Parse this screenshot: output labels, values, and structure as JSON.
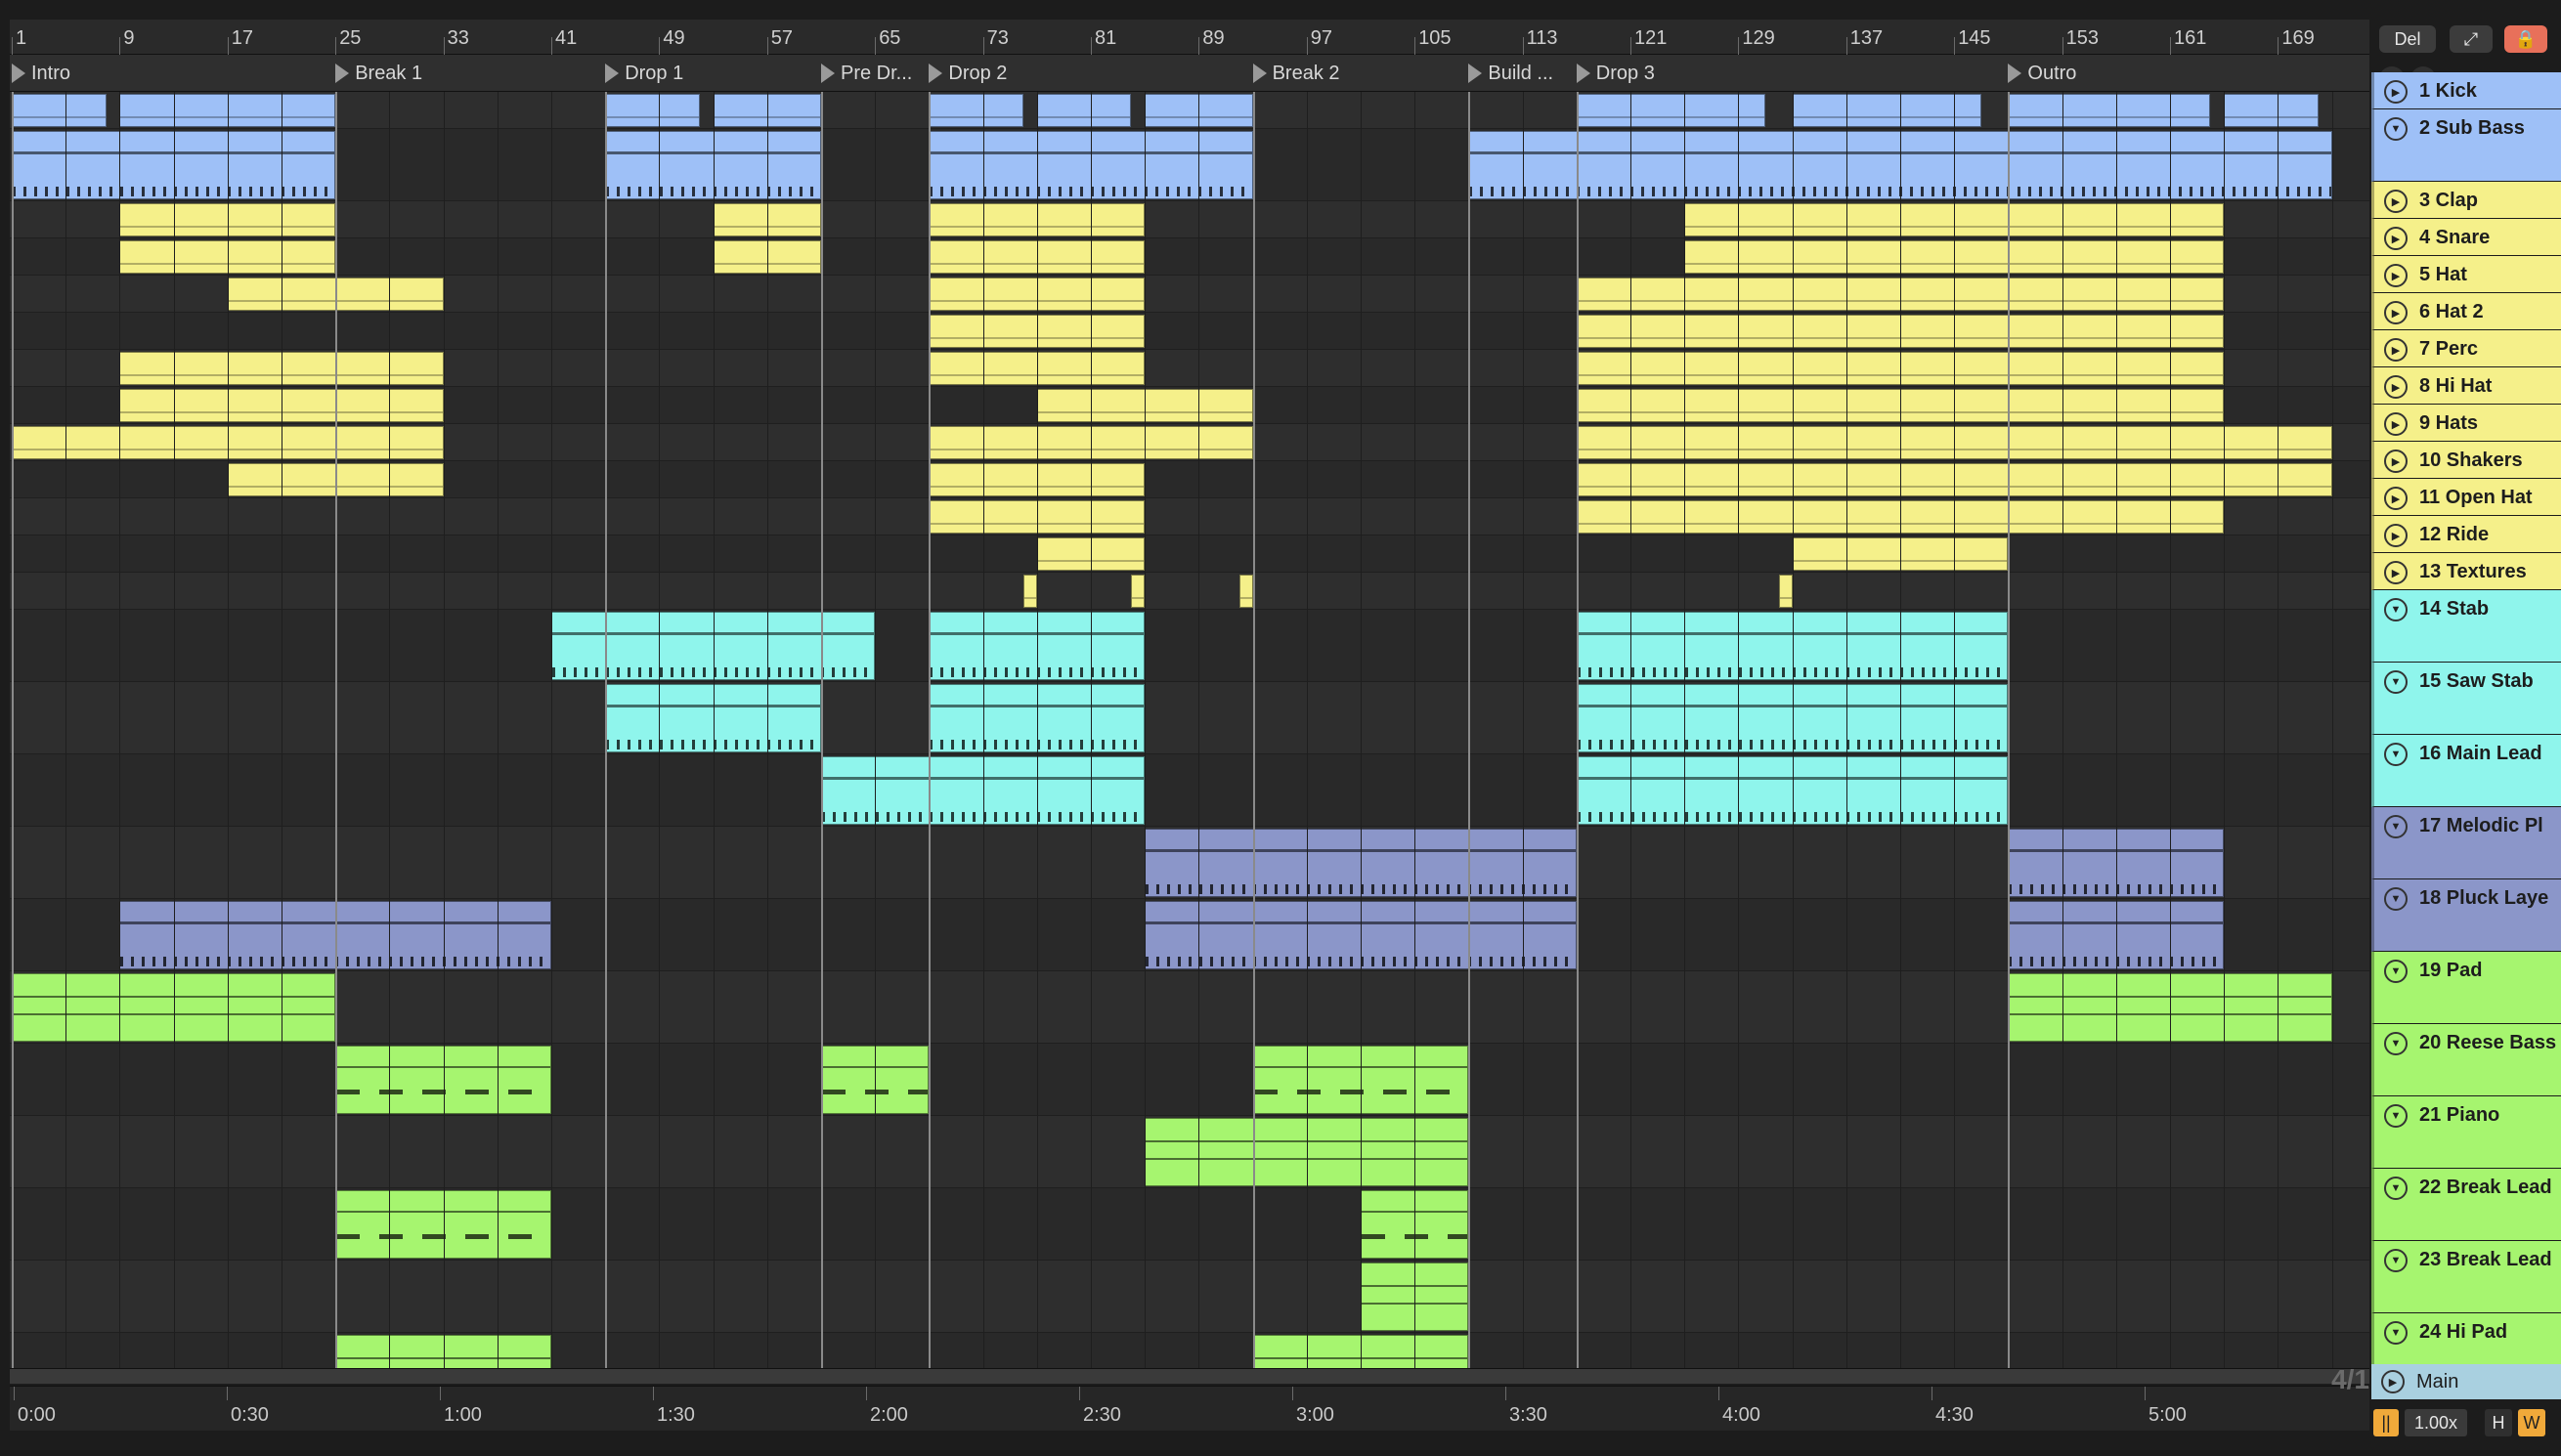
{
  "colors": {
    "blue": "#9ec0f7",
    "yellow": "#f5f08a",
    "cyan": "#8ff5ec",
    "violet": "#8b96c9",
    "green": "#a6f56f",
    "main": "#a9d0e0",
    "lock": "#e8705a",
    "orange": "#f0a93a"
  },
  "ruler": {
    "bars": [
      "1",
      "9",
      "17",
      "25",
      "33",
      "41",
      "49",
      "57",
      "65",
      "73",
      "81",
      "89",
      "97",
      "105",
      "113",
      "121",
      "129",
      "137",
      "145",
      "153",
      "161",
      "169"
    ]
  },
  "locators": [
    {
      "name": "Intro",
      "bar": 1
    },
    {
      "name": "Break 1",
      "bar": 25
    },
    {
      "name": "Drop 1",
      "bar": 45
    },
    {
      "name": "Pre Dr...",
      "bar": 61
    },
    {
      "name": "Drop 2",
      "bar": 69
    },
    {
      "name": "Break 2",
      "bar": 93
    },
    {
      "name": "Build ...",
      "bar": 109
    },
    {
      "name": "Drop 3",
      "bar": 117
    },
    {
      "name": "Outro",
      "bar": 149
    }
  ],
  "timeline": {
    "labels": [
      "0:00",
      "0:30",
      "1:00",
      "1:30",
      "2:00",
      "2:30",
      "3:00",
      "3:30",
      "4:00",
      "4:30",
      "5:00"
    ]
  },
  "zoom_readout": "4/1",
  "header_controls": {
    "del_label": "Del",
    "tempo_scale": "1.00x",
    "h_label": "H",
    "w_label": "W"
  },
  "main_track": {
    "name": "Main"
  },
  "tracks": [
    {
      "name": "1 Kick",
      "color": "blue",
      "h": 38,
      "kind": "audio",
      "clips": [
        [
          1,
          8
        ],
        [
          9,
          25
        ],
        [
          45,
          52
        ],
        [
          53,
          61
        ],
        [
          69,
          76
        ],
        [
          77,
          84
        ],
        [
          85,
          93
        ],
        [
          117,
          131
        ],
        [
          133,
          147
        ],
        [
          149,
          164
        ],
        [
          165,
          172
        ]
      ]
    },
    {
      "name": "2 Sub Bass",
      "color": "blue",
      "h": 74,
      "kind": "midi",
      "clips": [
        [
          1,
          25
        ],
        [
          45,
          61
        ],
        [
          69,
          93
        ],
        [
          109,
          173
        ]
      ]
    },
    {
      "name": "3 Clap",
      "color": "yellow",
      "h": 38,
      "kind": "audio",
      "clips": [
        [
          9,
          25
        ],
        [
          53,
          61
        ],
        [
          69,
          85
        ],
        [
          125,
          165
        ]
      ]
    },
    {
      "name": "4 Snare",
      "color": "yellow",
      "h": 38,
      "kind": "audio",
      "clips": [
        [
          9,
          25
        ],
        [
          53,
          61
        ],
        [
          69,
          85
        ],
        [
          125,
          165
        ]
      ]
    },
    {
      "name": "5 Hat",
      "color": "yellow",
      "h": 38,
      "kind": "audio",
      "clips": [
        [
          17,
          33
        ],
        [
          69,
          85
        ],
        [
          117,
          165
        ]
      ]
    },
    {
      "name": "6 Hat 2",
      "color": "yellow",
      "h": 38,
      "kind": "audio",
      "clips": [
        [
          69,
          85
        ],
        [
          117,
          165
        ]
      ]
    },
    {
      "name": "7 Perc",
      "color": "yellow",
      "h": 38,
      "kind": "audio",
      "clips": [
        [
          9,
          33
        ],
        [
          69,
          85
        ],
        [
          117,
          165
        ]
      ]
    },
    {
      "name": "8 Hi Hat",
      "color": "yellow",
      "h": 38,
      "kind": "audio",
      "clips": [
        [
          9,
          33
        ],
        [
          77,
          93
        ],
        [
          117,
          165
        ]
      ]
    },
    {
      "name": "9 Hats",
      "color": "yellow",
      "h": 38,
      "kind": "audio",
      "clips": [
        [
          1,
          33
        ],
        [
          69,
          93
        ],
        [
          117,
          173
        ]
      ]
    },
    {
      "name": "10 Shakers",
      "color": "yellow",
      "h": 38,
      "kind": "audio",
      "clips": [
        [
          17,
          33
        ],
        [
          69,
          85
        ],
        [
          117,
          173
        ]
      ]
    },
    {
      "name": "11 Open Hat",
      "color": "yellow",
      "h": 38,
      "kind": "audio",
      "clips": [
        [
          69,
          85
        ],
        [
          117,
          165
        ]
      ]
    },
    {
      "name": "12 Ride",
      "color": "yellow",
      "h": 38,
      "kind": "audio",
      "clips": [
        [
          77,
          85
        ],
        [
          133,
          149
        ]
      ]
    },
    {
      "name": "13 Textures",
      "color": "yellow",
      "h": 38,
      "kind": "audio",
      "clips": [
        [
          76,
          77
        ],
        [
          84,
          85
        ],
        [
          92,
          93
        ],
        [
          132,
          133
        ]
      ]
    },
    {
      "name": "14 Stab",
      "color": "cyan",
      "h": 74,
      "kind": "midi",
      "clips": [
        [
          41,
          65
        ],
        [
          69,
          85
        ],
        [
          117,
          149
        ]
      ]
    },
    {
      "name": "15 Saw Stab",
      "color": "cyan",
      "h": 74,
      "kind": "midi",
      "clips": [
        [
          45,
          61
        ],
        [
          69,
          85
        ],
        [
          117,
          149
        ]
      ]
    },
    {
      "name": "16 Main Lead",
      "color": "cyan",
      "h": 74,
      "kind": "midi",
      "clips": [
        [
          61,
          85
        ],
        [
          117,
          149
        ]
      ]
    },
    {
      "name": "17 Melodic Pl",
      "color": "violet",
      "h": 74,
      "kind": "midi",
      "clips": [
        [
          85,
          117
        ],
        [
          149,
          165
        ]
      ]
    },
    {
      "name": "18 Pluck Laye",
      "color": "violet",
      "h": 74,
      "kind": "midi",
      "clips": [
        [
          9,
          41
        ],
        [
          85,
          117
        ],
        [
          149,
          165
        ]
      ]
    },
    {
      "name": "19 Pad",
      "color": "green",
      "h": 74,
      "kind": "pad",
      "clips": [
        [
          1,
          25
        ],
        [
          149,
          173
        ]
      ]
    },
    {
      "name": "20 Reese Bass",
      "color": "green",
      "h": 74,
      "kind": "bass",
      "clips": [
        [
          25,
          41
        ],
        [
          61,
          69
        ],
        [
          93,
          109
        ]
      ]
    },
    {
      "name": "21 Piano",
      "color": "green",
      "h": 74,
      "kind": "pad",
      "clips": [
        [
          85,
          109
        ]
      ]
    },
    {
      "name": "22 Break Lead",
      "color": "green",
      "h": 74,
      "kind": "bass",
      "clips": [
        [
          25,
          41
        ],
        [
          101,
          109
        ]
      ]
    },
    {
      "name": "23 Break Lead",
      "color": "green",
      "h": 74,
      "kind": "pad",
      "clips": [
        [
          101,
          109
        ]
      ]
    },
    {
      "name": "24 Hi Pad",
      "color": "green",
      "h": 74,
      "kind": "pad",
      "clips": [
        [
          25,
          41
        ],
        [
          93,
          109
        ]
      ]
    }
  ]
}
